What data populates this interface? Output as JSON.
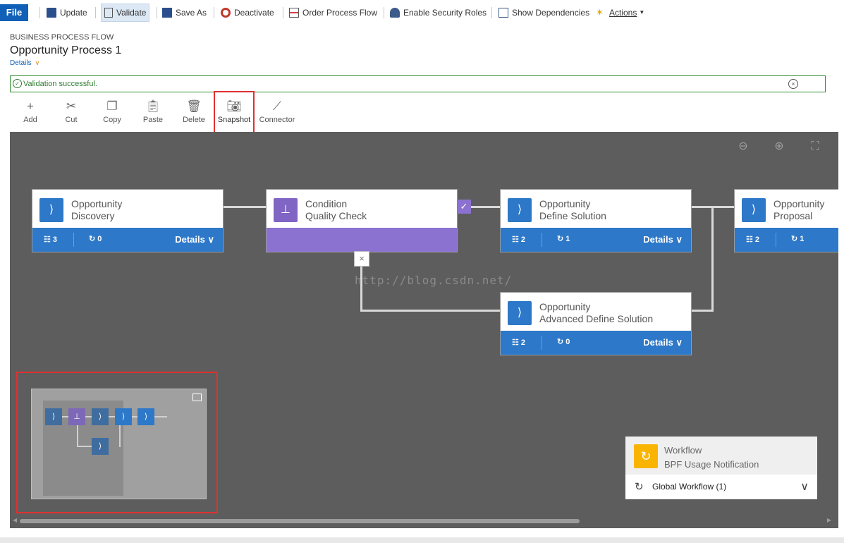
{
  "ribbon": {
    "file": "File",
    "update": "Update",
    "validate": "Validate",
    "save_as": "Save As",
    "deactivate": "Deactivate",
    "order_process_flow": "Order Process Flow",
    "enable_security_roles": "Enable Security Roles",
    "show_dependencies": "Show Dependencies",
    "actions": "Actions"
  },
  "header": {
    "entity_type": "BUSINESS PROCESS FLOW",
    "title": "Opportunity Process 1",
    "details": "Details"
  },
  "notification": {
    "message": "Validation successful."
  },
  "toolbar": {
    "add": "Add",
    "cut": "Cut",
    "copy": "Copy",
    "paste": "Paste",
    "delete": "Delete",
    "snapshot": "Snapshot",
    "connector": "Connector"
  },
  "stages": [
    {
      "line1": "Opportunity",
      "line2": "Discovery",
      "steps": "3",
      "workflows": "0",
      "details": "Details"
    },
    {
      "line1": "Condition",
      "line2": "Quality Check"
    },
    {
      "line1": "Opportunity",
      "line2": "Define Solution",
      "steps": "2",
      "workflows": "1",
      "details": "Details"
    },
    {
      "line1": "Opportunity",
      "line2": "Proposal",
      "steps": "2",
      "workflows": "1"
    },
    {
      "line1": "Opportunity",
      "line2": "Advanced Define Solution",
      "steps": "2",
      "workflows": "0",
      "details": "Details"
    }
  ],
  "watermark": "http://blog.csdn.net/",
  "workflow_card": {
    "title": "Workflow",
    "name": "BPF Usage Notification",
    "global": "Global Workflow (1)"
  }
}
